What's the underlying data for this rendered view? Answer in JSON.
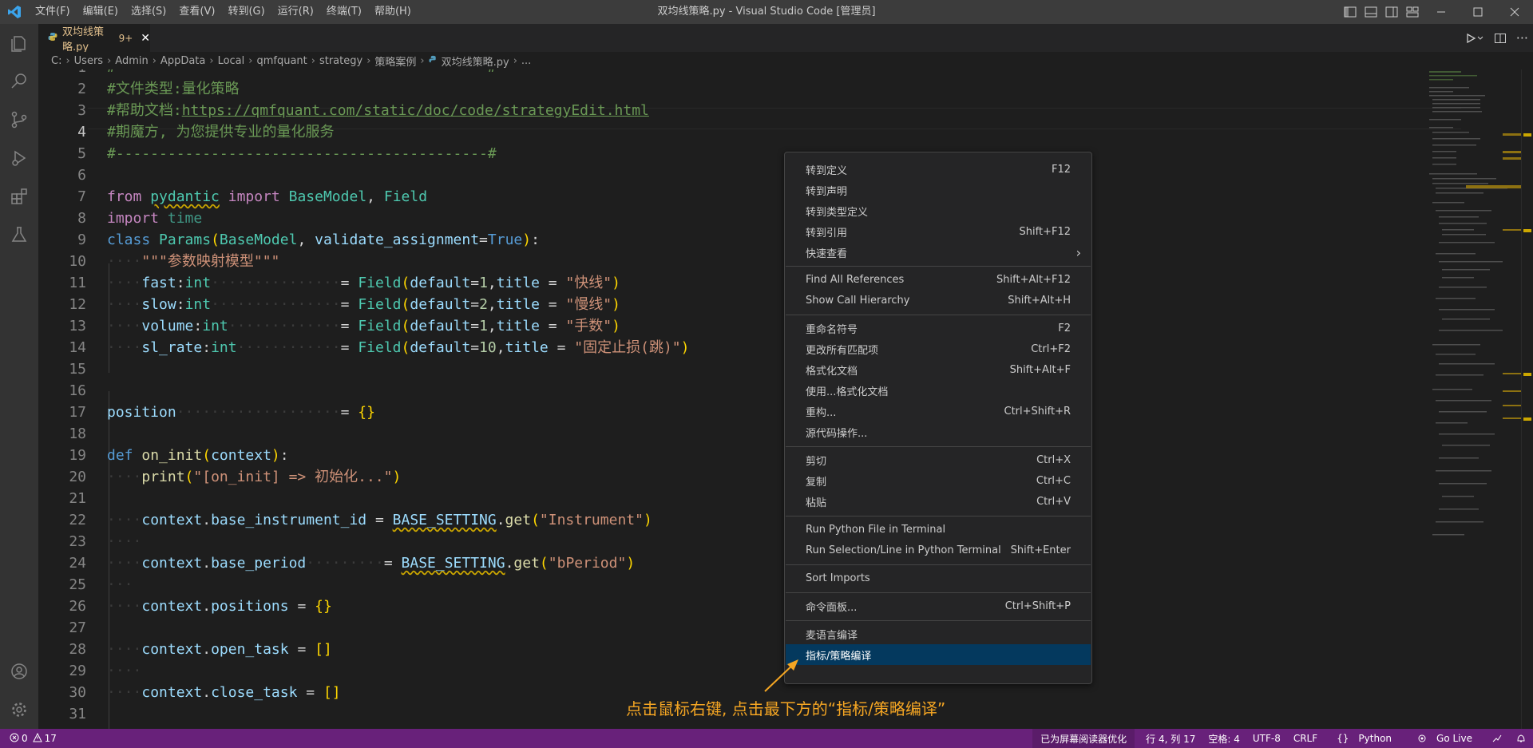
{
  "window": {
    "title": "双均线策略.py - Visual Studio Code [管理员]",
    "menu": [
      "文件(F)",
      "编辑(E)",
      "选择(S)",
      "查看(V)",
      "转到(G)",
      "运行(R)",
      "终端(T)",
      "帮助(H)"
    ]
  },
  "tab": {
    "name": "双均线策略.py",
    "problems": "9+"
  },
  "breadcrumb": [
    "C:",
    "Users",
    "Admin",
    "AppData",
    "Local",
    "qmfquant",
    "strategy",
    "策略案例",
    "双均线策略.py",
    "..."
  ],
  "code": {
    "line_numbers": [
      "1",
      "2",
      "3",
      "4",
      "5",
      "6",
      "7",
      "8",
      "9",
      "10",
      "11",
      "12",
      "13",
      "14",
      "15",
      "16",
      "17",
      "18",
      "19",
      "20",
      "21",
      "22",
      "23",
      "24",
      "25",
      "26",
      "27",
      "28",
      "29",
      "30",
      "31"
    ],
    "active_line": 4,
    "l1": "#-------------------------------------------#",
    "l2": "#文件类型:量化策略",
    "l3a": "#帮助文档:",
    "l3b": "https://qmfquant.com/static/doc/code/strategyEdit.html",
    "l4": "#期魔方, 为您提供专业的量化服务",
    "l5": "#-------------------------------------------#",
    "l7": [
      "from",
      "pydantic",
      "import",
      "BaseModel",
      "Field"
    ],
    "l8": [
      "import",
      "time"
    ],
    "l9": [
      "class",
      "Params",
      "BaseModel",
      "validate_assignment",
      "True"
    ],
    "l10": "\"\"\"参数映射模型\"\"\"",
    "params": [
      {
        "name": "fast",
        "type": "int",
        "default": "1",
        "title": "\"快线\""
      },
      {
        "name": "slow",
        "type": "int",
        "default": "2",
        "title": "\"慢线\""
      },
      {
        "name": "volume",
        "type": "int",
        "default": "1",
        "title": "\"手数\""
      },
      {
        "name": "sl_rate",
        "type": "int",
        "default": "10",
        "title": "\"固定止损(跳)\""
      }
    ],
    "l17": [
      "position",
      "{}"
    ],
    "l19": [
      "def",
      "on_init",
      "context"
    ],
    "l20": [
      "print",
      "\"[on_init] => 初始化...\""
    ],
    "l22": [
      "context",
      "base_instrument_id",
      "BASE_SETTING",
      "get",
      "\"Instrument\""
    ],
    "l24": [
      "context",
      "base_period",
      "BASE_SETTING",
      "get",
      "\"bPeriod\""
    ],
    "l26": [
      "context",
      "positions",
      "{}"
    ],
    "l28": [
      "context",
      "open_task",
      "[]"
    ],
    "l30": [
      "context",
      "close_task",
      "[]"
    ],
    "kw_field": "Field",
    "kw_default": "default",
    "kw_title": "title"
  },
  "context_menu": {
    "groups": [
      [
        {
          "label": "转到定义",
          "key": "F12"
        },
        {
          "label": "转到声明",
          "key": ""
        },
        {
          "label": "转到类型定义",
          "key": ""
        },
        {
          "label": "转到引用",
          "key": "Shift+F12"
        },
        {
          "label": "快速查看",
          "key": "›"
        }
      ],
      [
        {
          "label": "Find All References",
          "key": "Shift+Alt+F12"
        },
        {
          "label": "Show Call Hierarchy",
          "key": "Shift+Alt+H"
        }
      ],
      [
        {
          "label": "重命名符号",
          "key": "F2"
        },
        {
          "label": "更改所有匹配项",
          "key": "Ctrl+F2"
        },
        {
          "label": "格式化文档",
          "key": "Shift+Alt+F"
        },
        {
          "label": "使用...格式化文档",
          "key": ""
        },
        {
          "label": "重构...",
          "key": "Ctrl+Shift+R"
        },
        {
          "label": "源代码操作...",
          "key": ""
        }
      ],
      [
        {
          "label": "剪切",
          "key": "Ctrl+X"
        },
        {
          "label": "复制",
          "key": "Ctrl+C"
        },
        {
          "label": "粘贴",
          "key": "Ctrl+V"
        }
      ],
      [
        {
          "label": "Run Python File in Terminal",
          "key": ""
        },
        {
          "label": "Run Selection/Line in Python Terminal",
          "key": "Shift+Enter"
        }
      ],
      [
        {
          "label": "Sort Imports",
          "key": ""
        }
      ],
      [
        {
          "label": "命令面板...",
          "key": "Ctrl+Shift+P"
        }
      ],
      [
        {
          "label": "麦语言编译",
          "key": ""
        },
        {
          "label": "指标/策略编译",
          "key": "",
          "selected": true
        }
      ]
    ]
  },
  "annotation": "点击鼠标右键, 点击最下方的“指标/策略编译”",
  "status": {
    "errors": "0",
    "warnings": "17",
    "screen_reader": "已为屏幕阅读器优化",
    "position": "行 4, 列 17",
    "spaces": "空格: 4",
    "encoding": "UTF-8",
    "eol": "CRLF",
    "language": "Python",
    "golive": "Go Live"
  },
  "colors": {
    "accent": "#007acc",
    "statusbar": "#68217a",
    "selection": "#04395e",
    "annotation": "#f5a623"
  }
}
